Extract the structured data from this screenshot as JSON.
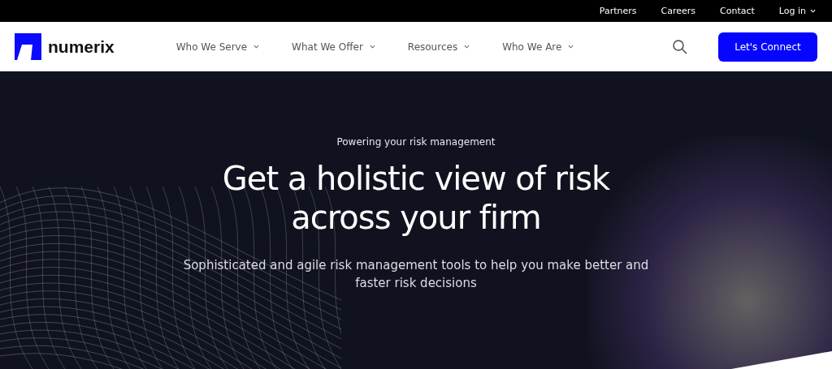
{
  "top_bar": {
    "links": [
      {
        "label": "Partners",
        "dropdown": false
      },
      {
        "label": "Careers",
        "dropdown": false
      },
      {
        "label": "Contact",
        "dropdown": false
      },
      {
        "label": "Log in",
        "dropdown": true
      }
    ]
  },
  "nav": {
    "logo": "numerix",
    "items": [
      {
        "label": "Who We Serve"
      },
      {
        "label": "What We Offer"
      },
      {
        "label": "Resources"
      },
      {
        "label": "Who We Are"
      }
    ],
    "cta": "Let's Connect"
  },
  "hero": {
    "eyebrow": "Powering your risk management",
    "title_lines": [
      "Get a holistic view of risk",
      "across your firm"
    ],
    "subtitle_lines": [
      "Sophisticated and agile risk management tools to help you make better and",
      "faster risk decisions"
    ]
  }
}
